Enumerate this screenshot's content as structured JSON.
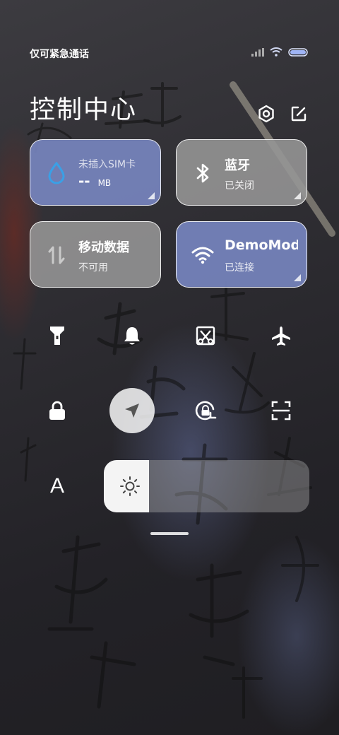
{
  "status_bar": {
    "carrier": "仅可紧急通话"
  },
  "header": {
    "title": "控制中心"
  },
  "tiles": [
    {
      "line1": "未插入SIM卡",
      "line2": "-- ",
      "unit": "MB"
    },
    {
      "label": "蓝牙",
      "status": "已关闭"
    },
    {
      "label": "移动数据",
      "status": "不可用"
    },
    {
      "label": "DemoMod",
      "status": "已连接"
    }
  ],
  "toggles": [
    {
      "name": "flashlight",
      "active": false
    },
    {
      "name": "bell",
      "active": false
    },
    {
      "name": "screenshot",
      "active": false
    },
    {
      "name": "airplane",
      "active": false
    },
    {
      "name": "lock",
      "active": false
    },
    {
      "name": "location",
      "active": true
    },
    {
      "name": "rotation-lock",
      "active": false
    },
    {
      "name": "scanner",
      "active": false
    }
  ],
  "reading_mode_label": "A",
  "brightness": {
    "level": 0.22
  },
  "colors": {
    "blue_tile": "#7684be",
    "gray_tile": "#969696",
    "accent_water": "#3aa0e6"
  }
}
